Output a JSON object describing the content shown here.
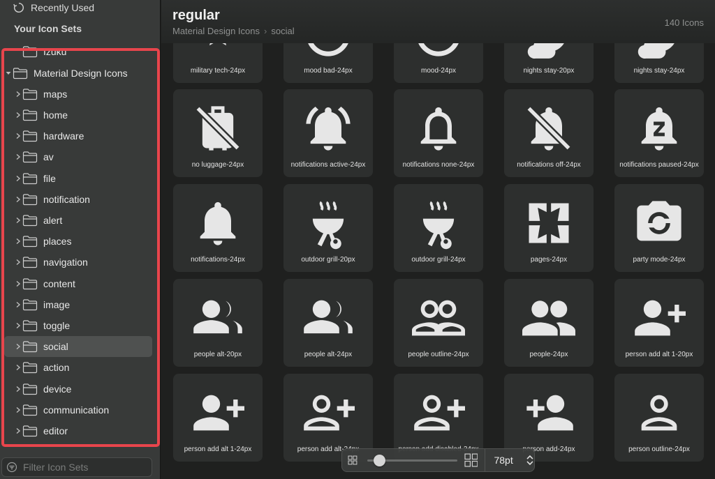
{
  "sidebar": {
    "recent_label": "Recently Used",
    "section_title": "Your Icon Sets",
    "top_item_partial": "Izuku",
    "tree_root": "Material Design Icons",
    "folders": [
      "maps",
      "home",
      "hardware",
      "av",
      "file",
      "notification",
      "alert",
      "places",
      "navigation",
      "content",
      "image",
      "toggle",
      "social",
      "action",
      "device",
      "communication",
      "editor"
    ],
    "selected_folder": "social",
    "filter_placeholder": "Filter Icon Sets"
  },
  "header": {
    "title": "regular",
    "breadcrumb": [
      "Material Design Icons",
      "social"
    ],
    "icon_count": "140 Icons"
  },
  "icons": [
    {
      "label": "military tech-24px",
      "icon": "military-tech-icon"
    },
    {
      "label": "mood bad-24px",
      "icon": "mood-bad-icon"
    },
    {
      "label": "mood-24px",
      "icon": "mood-icon"
    },
    {
      "label": "nights stay-20px",
      "icon": "nights-stay-icon"
    },
    {
      "label": "nights stay-24px",
      "icon": "nights-stay-icon"
    },
    {
      "label": "no luggage-24px",
      "icon": "no-luggage-icon"
    },
    {
      "label": "notifications active-24px",
      "icon": "notifications-active-icon"
    },
    {
      "label": "notifications none-24px",
      "icon": "notifications-none-icon"
    },
    {
      "label": "notifications off-24px",
      "icon": "notifications-off-icon"
    },
    {
      "label": "notifications paused-24px",
      "icon": "notifications-paused-icon"
    },
    {
      "label": "notifications-24px",
      "icon": "notifications-icon"
    },
    {
      "label": "outdoor grill-20px",
      "icon": "outdoor-grill-icon"
    },
    {
      "label": "outdoor grill-24px",
      "icon": "outdoor-grill-icon"
    },
    {
      "label": "pages-24px",
      "icon": "pages-icon"
    },
    {
      "label": "party mode-24px",
      "icon": "party-mode-icon"
    },
    {
      "label": "people alt-20px",
      "icon": "people-alt-icon"
    },
    {
      "label": "people alt-24px",
      "icon": "people-alt-icon"
    },
    {
      "label": "people outline-24px",
      "icon": "people-outline-icon"
    },
    {
      "label": "people-24px",
      "icon": "people-icon"
    },
    {
      "label": "person add alt 1-20px",
      "icon": "person-add-alt-icon"
    },
    {
      "label": "person add alt 1-24px",
      "icon": "person-add-alt-icon"
    },
    {
      "label": "person add alt-24px",
      "icon": "person-add-outline-icon"
    },
    {
      "label": "person add disabled-24px",
      "icon": "person-add-outline-icon"
    },
    {
      "label": "person add-24px",
      "icon": "person-add-icon"
    },
    {
      "label": "person outline-24px",
      "icon": "person-outline-icon"
    }
  ],
  "size_control": {
    "value": "78pt",
    "slider_fraction": 0.08
  },
  "colors": {
    "accent_highlight": "#e8454c",
    "glyph": "#e6e6e6"
  }
}
